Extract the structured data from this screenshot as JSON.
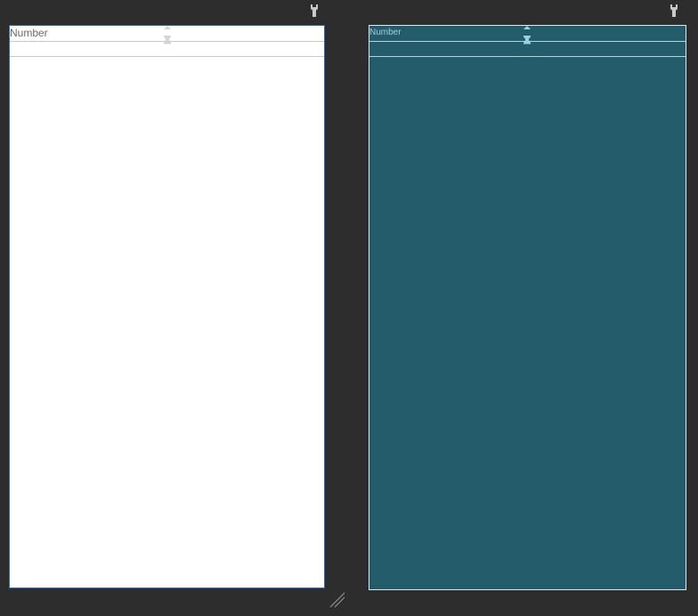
{
  "design_view": {
    "field_label": "Number",
    "surface_color": "#ffffff",
    "border_color": "#2e6bb8"
  },
  "blueprint_view": {
    "field_label": "Number",
    "surface_color": "#245c6c",
    "border_color": "#dde9ee"
  },
  "icons": {
    "design_wrench": "wrench-icon",
    "blueprint_wrench": "wrench-icon",
    "resize": "resize-handle-icon",
    "constraint": "vertical-constraint-icon"
  },
  "colors": {
    "background": "#2d2d2e"
  }
}
